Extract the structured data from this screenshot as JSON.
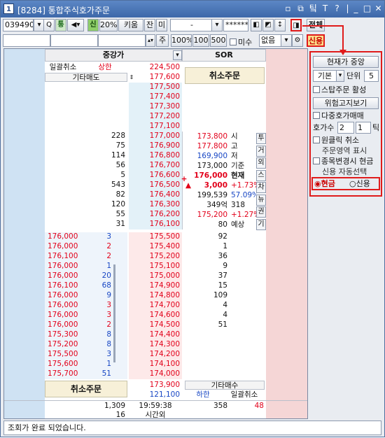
{
  "window": {
    "badge": "1",
    "title": "[8284] 통합주식호가주문",
    "controls": [
      "▫",
      "⧉",
      "팈",
      "T",
      "?",
      "|",
      "_",
      "□",
      "✕"
    ]
  },
  "toolbar1": {
    "code": "039490",
    "search": "Q",
    "tong": "통",
    "sound": "◀▾",
    "sin": "신",
    "pct20": "20%",
    "kium": "키움",
    "jan": "잔",
    "mi": "미",
    "account": "-",
    "password": "******",
    "jeonche": "전체"
  },
  "toolbar2": {
    "qty": "",
    "ju": "주",
    "p100": "100%",
    "q100": "100",
    "q500": "500",
    "misu": "미수",
    "none": "없음",
    "credit": "신용"
  },
  "grid": {
    "header_mid": "중강가",
    "header_sor": "SOR",
    "ilgwal": "일괄취소",
    "sanghan": "상한",
    "upper_price": "224,500",
    "gita_maedo": "기타매도",
    "gita_price": "177,600",
    "cancel_top": "취소주문",
    "ask_rows": [
      {
        "qty": "",
        "price": "177,500"
      },
      {
        "qty": "",
        "price": "177,400"
      },
      {
        "qty": "",
        "price": "177,300"
      },
      {
        "qty": "",
        "price": "177,200"
      },
      {
        "qty": "",
        "price": "177,100"
      },
      {
        "qty": "228",
        "price": "177,000"
      },
      {
        "qty": "75",
        "price": "176,900"
      },
      {
        "qty": "114",
        "price": "176,800"
      },
      {
        "qty": "56",
        "price": "176,700"
      },
      {
        "qty": "5",
        "price": "176,600"
      },
      {
        "qty": "543",
        "price": "176,500"
      },
      {
        "qty": "82",
        "price": "176,400"
      },
      {
        "qty": "120",
        "price": "176,300"
      },
      {
        "qty": "55",
        "price": "176,200"
      },
      {
        "qty": "31",
        "price": "176,100"
      }
    ],
    "info_rows": [
      {
        "val": "173,800",
        "lbl": "시",
        "cls": "red"
      },
      {
        "val": "177,800",
        "lbl": "고",
        "cls": "red"
      },
      {
        "val": "169,900",
        "lbl": "저",
        "cls": "blue"
      },
      {
        "val": "173,000",
        "lbl": "기준",
        "cls": "black"
      }
    ],
    "current_price": "176,000",
    "current_label": "현재",
    "change": "3,000",
    "change_pct": "+1.73%",
    "volume": "199,539",
    "vol_pct": "57.09%",
    "amount": "349억",
    "amount_label": "318",
    "expected": "175,200",
    "expected_pct": "+1.27%",
    "expected_qty": "80",
    "expected_label": "예상",
    "side_tabs": [
      "투",
      "거",
      "외",
      "스",
      "차",
      "뉴",
      "권",
      "기"
    ],
    "bid_rows": [
      {
        "fill_price": "176,000",
        "fill_qty": "3",
        "price": "175,500",
        "qty": "92"
      },
      {
        "fill_price": "176,000",
        "fill_qty": "2",
        "price": "175,400",
        "qty": "1"
      },
      {
        "fill_price": "176,100",
        "fill_qty": "2",
        "price": "175,200",
        "qty": "36"
      },
      {
        "fill_price": "176,000",
        "fill_qty": "1",
        "price": "175,100",
        "qty": "9"
      },
      {
        "fill_price": "176,000",
        "fill_qty": "20",
        "price": "175,000",
        "qty": "37"
      },
      {
        "fill_price": "176,100",
        "fill_qty": "68",
        "price": "174,900",
        "qty": "15"
      },
      {
        "fill_price": "176,000",
        "fill_qty": "9",
        "price": "174,800",
        "qty": "109"
      },
      {
        "fill_price": "176,000",
        "fill_qty": "3",
        "price": "174,700",
        "qty": "4"
      },
      {
        "fill_price": "176,000",
        "fill_qty": "3",
        "price": "174,600",
        "qty": "4"
      },
      {
        "fill_price": "176,000",
        "fill_qty": "2",
        "price": "174,500",
        "qty": "51"
      },
      {
        "fill_price": "175,300",
        "fill_qty": "8",
        "price": "174,400",
        "qty": ""
      },
      {
        "fill_price": "175,200",
        "fill_qty": "8",
        "price": "174,300",
        "qty": ""
      },
      {
        "fill_price": "175,500",
        "fill_qty": "3",
        "price": "174,200",
        "qty": ""
      },
      {
        "fill_price": "175,600",
        "fill_qty": "1",
        "price": "174,100",
        "qty": ""
      },
      {
        "fill_price": "175,700",
        "fill_qty": "51",
        "price": "174,000",
        "qty": ""
      }
    ],
    "cancel_bottom": "취소주문",
    "low_price": "173,900",
    "gita_maesu": "기타매수",
    "hahan_price": "121,100",
    "hahan": "하한",
    "ilgwal2": "일괄취소",
    "total_ask": "1,309",
    "time": "19:59:38",
    "total_bid": "358",
    "diff": "48",
    "after_qty": "16",
    "after_label": "시간외"
  },
  "panel": {
    "current_dcenter": "현재가 중앙",
    "basic": "기본",
    "unit_label": "단위",
    "unit_val": "5",
    "stop_order": "스탑주문 활성",
    "risk_view": "위험고지보기",
    "multi": "다중호가매매",
    "hoga_label": "호가수",
    "hoga1": "2",
    "hoga2": "1",
    "tick": "틱",
    "oneclick": "원클릭 취소",
    "order_area": "주문영역 표시",
    "code_change": "종목변경시 현금",
    "credit_auto": "신용 자동선택",
    "cash": "현금",
    "credit": "신용"
  },
  "status": "조회가 완료 되었습니다."
}
